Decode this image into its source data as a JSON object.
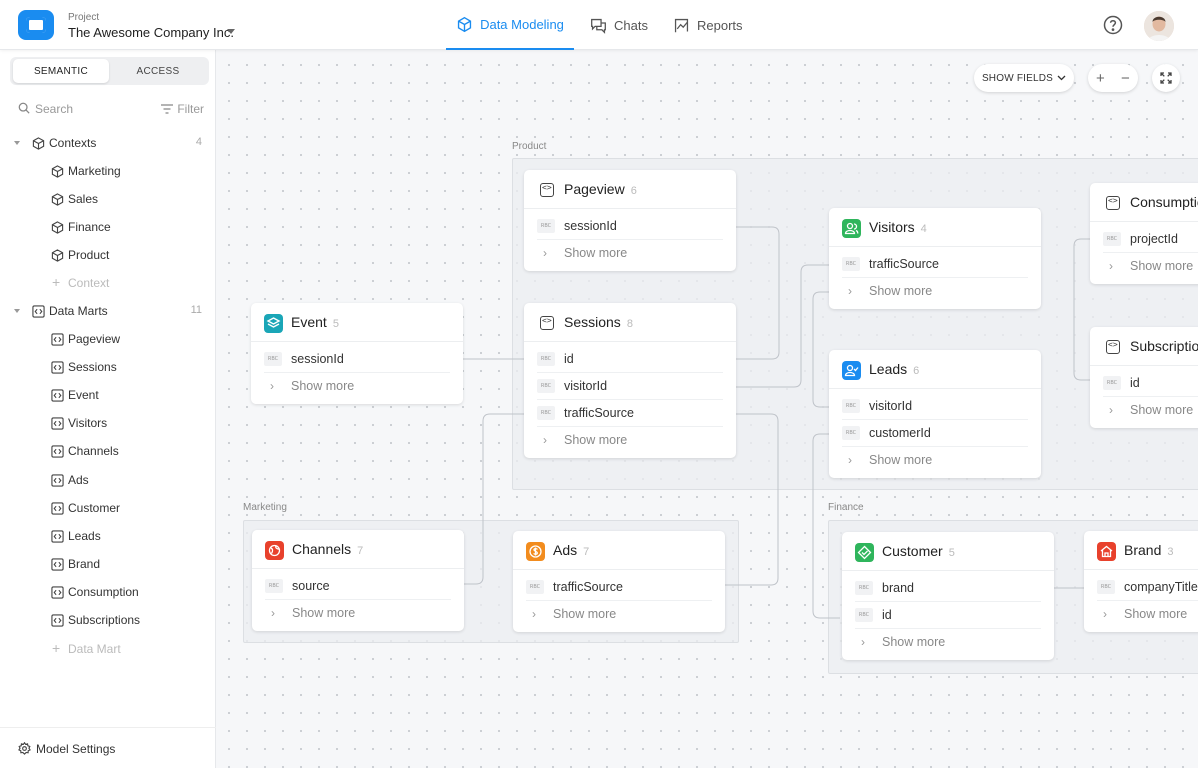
{
  "header": {
    "project_label": "Project",
    "project_name": "The Awesome Company Inc.",
    "tabs": [
      {
        "label": "Data Modeling",
        "active": true,
        "icon": "cube-icon"
      },
      {
        "label": "Chats",
        "active": false,
        "icon": "chat-icon"
      },
      {
        "label": "Reports",
        "active": false,
        "icon": "report-icon"
      }
    ],
    "accent_color": "#1a8cf0"
  },
  "sidebar": {
    "segments": [
      "SEMANTIC",
      "ACCESS"
    ],
    "active_segment": "SEMANTIC",
    "search_placeholder": "Search",
    "filter_label": "Filter",
    "contexts": {
      "label": "Contexts",
      "count": "4",
      "items": [
        "Marketing",
        "Sales",
        "Finance",
        "Product"
      ],
      "add_label": "Context"
    },
    "data_marts": {
      "label": "Data Marts",
      "count": "11",
      "items": [
        "Pageview",
        "Sessions",
        "Event",
        "Visitors",
        "Channels",
        "Ads",
        "Customer",
        "Leads",
        "Brand",
        "Consumption",
        "Subscriptions"
      ],
      "add_label": "Data Mart"
    },
    "settings_label": "Model Settings"
  },
  "canvas": {
    "show_fields_label": "SHOW FIELDS",
    "zoom_in": "+",
    "zoom_out": "−",
    "groups": {
      "product": "Product",
      "marketing": "Marketing",
      "finance": "Finance"
    },
    "field_type_badge": "RBC",
    "show_more": "Show more",
    "cards": {
      "pageview": {
        "title": "Pageview",
        "count": "6",
        "fields": [
          "sessionId"
        ]
      },
      "sessions": {
        "title": "Sessions",
        "count": "8",
        "fields": [
          "id",
          "visitorId",
          "trafficSource"
        ]
      },
      "event": {
        "title": "Event",
        "count": "5",
        "fields": [
          "sessionId"
        ]
      },
      "visitors": {
        "title": "Visitors",
        "count": "4",
        "fields": [
          "trafficSource"
        ]
      },
      "leads": {
        "title": "Leads",
        "count": "6",
        "fields": [
          "visitorId",
          "customerId"
        ]
      },
      "consumption": {
        "title": "Consumption",
        "count": "",
        "fields": [
          "projectId"
        ]
      },
      "subscriptions": {
        "title": "Subscriptions",
        "count": "",
        "fields": [
          "id"
        ]
      },
      "channels": {
        "title": "Channels",
        "count": "7",
        "fields": [
          "source"
        ]
      },
      "ads": {
        "title": "Ads",
        "count": "7",
        "fields": [
          "trafficSource"
        ]
      },
      "customer": {
        "title": "Customer",
        "count": "5",
        "fields": [
          "brand",
          "id"
        ]
      },
      "brand": {
        "title": "Brand",
        "count": "3",
        "fields": [
          "companyTitle"
        ]
      }
    }
  }
}
